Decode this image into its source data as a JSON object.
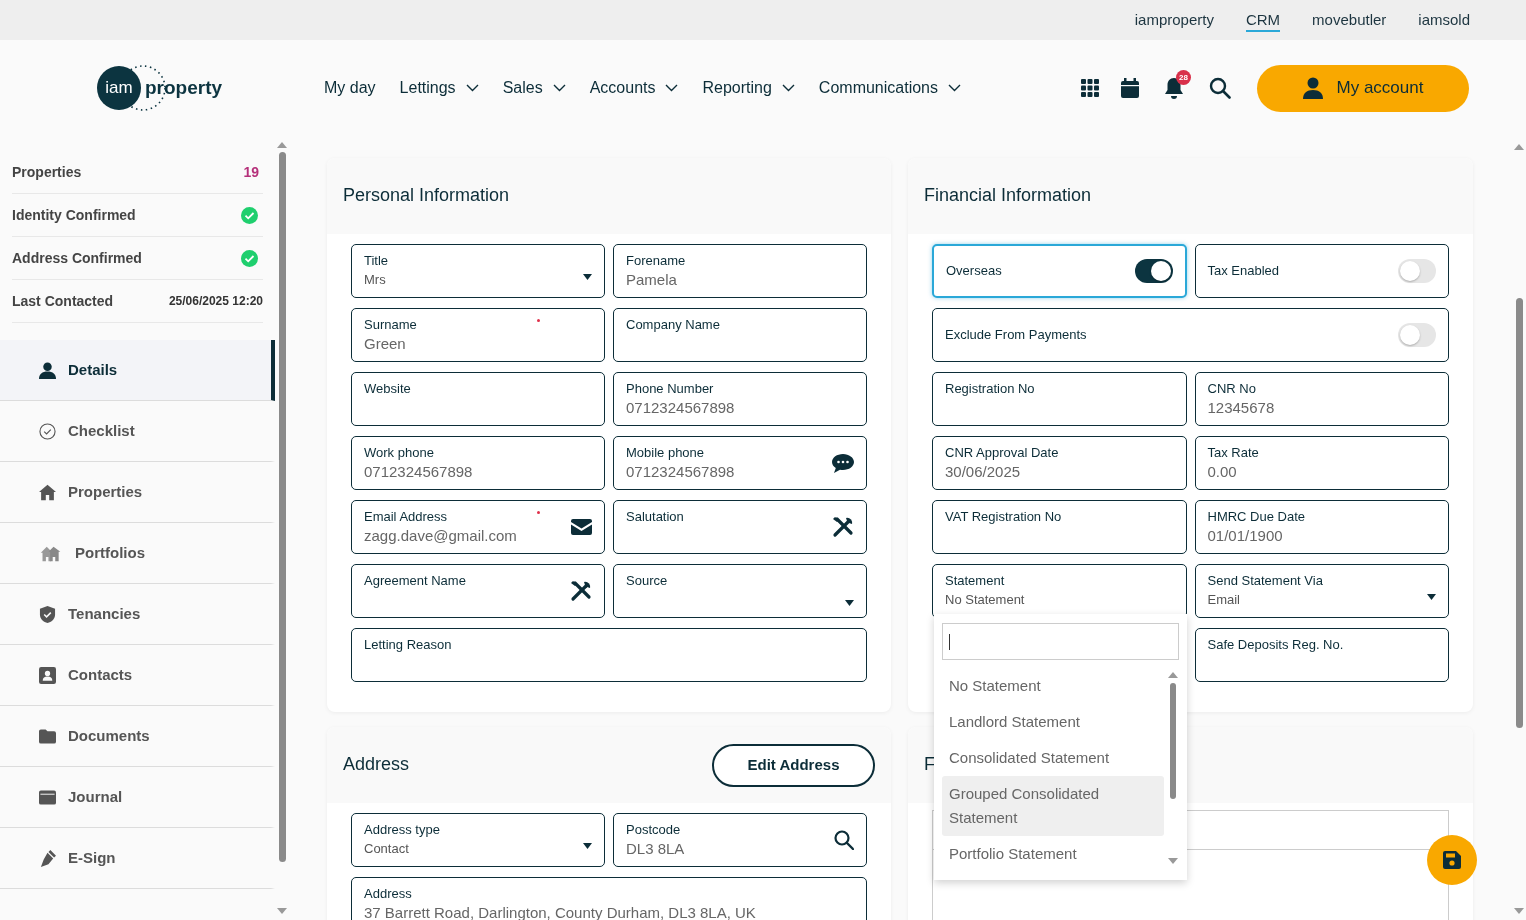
{
  "top_links": [
    {
      "label": "iamproperty",
      "selected": false
    },
    {
      "label": "CRM",
      "selected": true
    },
    {
      "label": "movebutler",
      "selected": false
    },
    {
      "label": "iamsold",
      "selected": false
    }
  ],
  "logo": {
    "mark": "iam",
    "wordmark": "property"
  },
  "nav": [
    {
      "label": "My day",
      "has_menu": false
    },
    {
      "label": "Lettings",
      "has_menu": true
    },
    {
      "label": "Sales",
      "has_menu": true
    },
    {
      "label": "Accounts",
      "has_menu": true
    },
    {
      "label": "Reporting",
      "has_menu": true
    },
    {
      "label": "Communications",
      "has_menu": true
    }
  ],
  "notifications": {
    "count": "28"
  },
  "account_button": {
    "label": "My account"
  },
  "summary": [
    {
      "kind": "count",
      "label": "Properties",
      "value": "19"
    },
    {
      "kind": "check",
      "label": "Identity Confirmed",
      "checked": true
    },
    {
      "kind": "check",
      "label": "Address Confirmed",
      "checked": true
    },
    {
      "kind": "date",
      "label": "Last Contacted",
      "value": "25/06/2025 12:20"
    }
  ],
  "side_menu": [
    {
      "label": "Details",
      "selected": true
    },
    {
      "label": "Checklist",
      "selected": false
    },
    {
      "label": "Properties",
      "selected": false
    },
    {
      "label": "Portfolios",
      "selected": false
    },
    {
      "label": "Tenancies",
      "selected": false
    },
    {
      "label": "Contacts",
      "selected": false
    },
    {
      "label": "Documents",
      "selected": false
    },
    {
      "label": "Journal",
      "selected": false
    },
    {
      "label": "E-Sign",
      "selected": false
    }
  ],
  "personal": {
    "title": "Personal Information",
    "fields": [
      {
        "label": "Title",
        "value": "Mrs",
        "kind": "select",
        "required": false,
        "wide": false
      },
      {
        "label": "Forename",
        "value": "Pamela",
        "kind": "text",
        "required": false,
        "wide": false
      },
      {
        "label": "Surname",
        "value": "Green",
        "kind": "text",
        "required": true,
        "wide": false
      },
      {
        "label": "Company Name",
        "kind": "text",
        "required": false,
        "wide": false
      },
      {
        "label": "Website",
        "kind": "text",
        "required": false,
        "wide": false
      },
      {
        "label": "Phone Number",
        "value": "0712324567898",
        "kind": "text",
        "required": false,
        "wide": false
      },
      {
        "label": "Work phone",
        "value": "0712324567898",
        "kind": "text",
        "required": false,
        "wide": false
      },
      {
        "label": "Mobile phone",
        "value": "0712324567898",
        "kind": "sms",
        "required": false,
        "wide": false
      },
      {
        "label": "Email Address",
        "value": "zagg.dave@gmail.com",
        "kind": "email",
        "required": true,
        "wide": false
      },
      {
        "label": "Salutation",
        "kind": "tools",
        "required": false,
        "wide": false
      },
      {
        "label": "Agreement Name",
        "kind": "tools",
        "required": false,
        "wide": false
      },
      {
        "label": "Source",
        "kind": "select",
        "required": false,
        "wide": false
      },
      {
        "label": "Letting Reason",
        "kind": "text",
        "required": false,
        "wide": true
      }
    ]
  },
  "address": {
    "title": "Address",
    "button": "Edit Address",
    "fields": [
      {
        "label": "Address type",
        "value": "Contact",
        "kind": "select",
        "required": false,
        "wide": false
      },
      {
        "label": "Postcode",
        "value": "DL3 8LA",
        "kind": "search",
        "required": false,
        "wide": false
      },
      {
        "label": "Address",
        "value": "37 Barrett Road, Darlington, County Durham, DL3 8LA, UK",
        "kind": "text",
        "required": false,
        "wide": true
      }
    ]
  },
  "financial": {
    "title": "Financial Information",
    "fields": [
      {
        "label": "Overseas",
        "kind": "toggle",
        "on": true,
        "focused": true,
        "wide": false
      },
      {
        "label": "Tax Enabled",
        "kind": "toggle",
        "on": false,
        "focused": false,
        "wide": false
      },
      {
        "label": "Exclude From Payments",
        "kind": "toggle",
        "on": false,
        "focused": false,
        "wide": true
      },
      {
        "label": "Registration No",
        "kind": "text",
        "wide": false
      },
      {
        "label": "CNR No",
        "value": "12345678",
        "kind": "text",
        "wide": false
      },
      {
        "label": "CNR Approval Date",
        "value": "30/06/2025",
        "kind": "text",
        "wide": false
      },
      {
        "label": "Tax Rate",
        "value": "0.00",
        "kind": "text",
        "wide": false
      },
      {
        "label": "VAT Registration No",
        "kind": "text",
        "wide": false
      },
      {
        "label": "HMRC Due Date",
        "value": "01/01/1900",
        "kind": "text",
        "wide": false
      },
      {
        "label": "Statement",
        "value": "No Statement",
        "kind": "select",
        "open": true,
        "wide": false
      },
      {
        "label": "Send Statement Via",
        "value": "Email",
        "kind": "select",
        "open": false,
        "wide": false
      },
      {
        "label": "Safe Deposits Reg. No.",
        "kind": "text",
        "wide": false
      }
    ],
    "dropdown": {
      "options": [
        {
          "label": "No Statement",
          "highlighted": false
        },
        {
          "label": "Landlord Statement",
          "highlighted": false
        },
        {
          "label": "Consolidated Statement",
          "highlighted": false
        },
        {
          "label": "Grouped Consolidated Statement",
          "highlighted": true
        },
        {
          "label": "Portfolio Statement",
          "highlighted": false
        }
      ]
    }
  },
  "notes_card": {
    "title": "F"
  }
}
